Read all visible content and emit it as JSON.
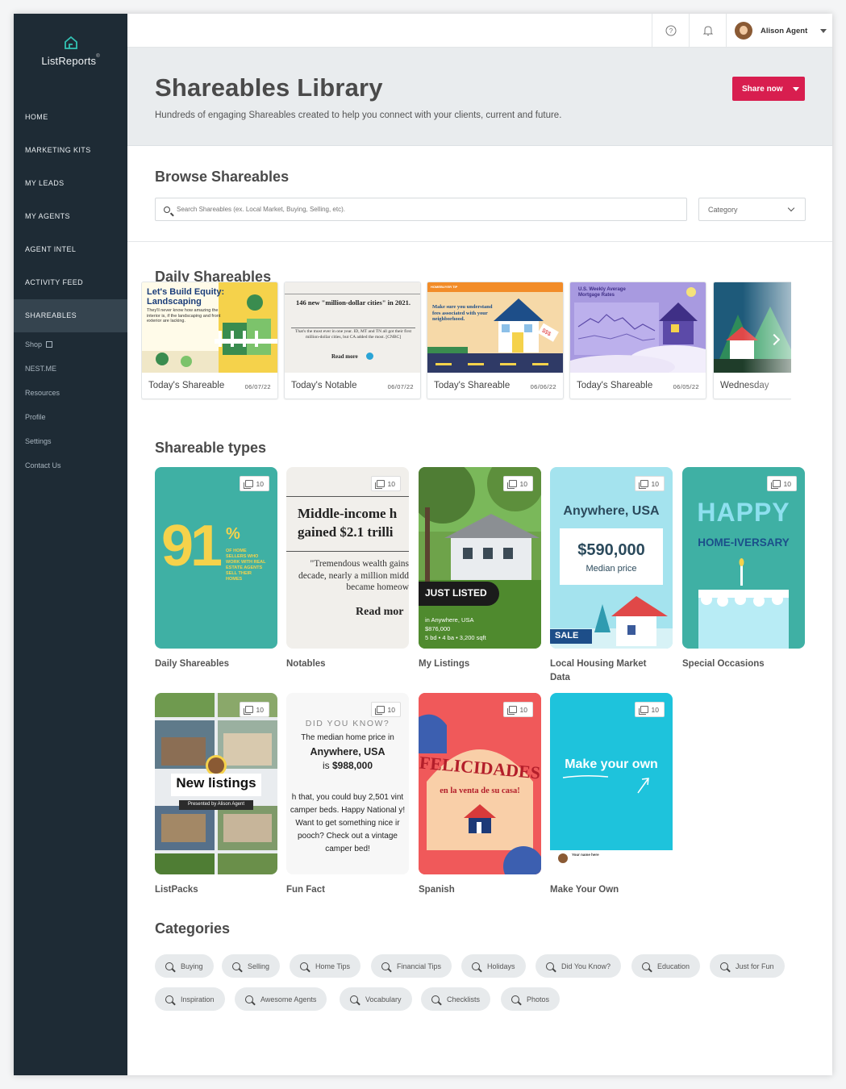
{
  "app": {
    "logo": "ListReports",
    "logo_mark": "®"
  },
  "sidebar": {
    "main": [
      "HOME",
      "MARKETING KITS",
      "MY LEADS",
      "MY AGENTS",
      "AGENT INTEL",
      "ACTIVITY FEED",
      "SHAREABLES"
    ],
    "active": "SHAREABLES",
    "sub": [
      "Shop",
      "NEST.ME",
      "Resources",
      "Profile",
      "Settings",
      "Contact Us"
    ]
  },
  "topbar": {
    "user_name": "Alison Agent"
  },
  "header": {
    "title": "Shareables Library",
    "subtitle": "Hundreds of engaging Shareables created to help you connect with your clients, current and future.",
    "share_button": "Share now"
  },
  "browse": {
    "title": "Browse Shareables",
    "search_placeholder": "Search Shareables (ex. Local Market, Buying, Selling, etc).",
    "category_label": "Category"
  },
  "daily": {
    "title": "Daily Shareables",
    "cards": [
      {
        "label": "Today's Shareable",
        "date": "06/07/22",
        "headline": "Let's Build Equity: Landscaping",
        "body": "They'll never know how amazing the interior is, if the landscaping and front exterior are lacking."
      },
      {
        "label": "Today's Notable",
        "date": "06/07/22",
        "headline": "146 new \"million-dollar cities\" in 2021.",
        "body": "That's the most ever in one year. ID, MT and TN all got their first million-dollar cities, but CA added the most. [CNBC]",
        "cta": "Read more"
      },
      {
        "label": "Today's Shareable",
        "date": "06/06/22",
        "tag": "HOMEBUYER TIP",
        "headline": "Make sure you understand fees associated with your neighborhood."
      },
      {
        "label": "Today's Shareable",
        "date": "06/05/22",
        "headline": "U.S. Weekly Average Mortgage Rates"
      },
      {
        "label": "Wednesday",
        "date": ""
      }
    ]
  },
  "types": {
    "title": "Shareable types",
    "items": [
      {
        "label": "Daily Shareables",
        "count": "10",
        "big": "91",
        "small": "%",
        "caption": "OF HOME SELLERS WHO WORK WITH REAL ESTATE AGENTS SELL THEIR HOMES"
      },
      {
        "label": "Notables",
        "count": "10",
        "headline": "Middle-income h gained $2.1 trilli",
        "body": "\"Tremendous wealth gains decade, nearly a million midd became homeow",
        "cta": "Read mor"
      },
      {
        "label": "My Listings",
        "count": "10",
        "badge": "JUST LISTED",
        "location": "in Anywhere, USA",
        "price": "$876,000",
        "specs": "5 bd • 4 ba • 3,200 sqft"
      },
      {
        "label": "Local Housing Market Data",
        "count": "10",
        "place": "Anywhere, USA",
        "price": "$590,000",
        "price_label": "Median price",
        "tag": "SALE"
      },
      {
        "label": "Special Occasions",
        "count": "10",
        "big": "HAPPY",
        "sub": "HOME-IVERSARY"
      },
      {
        "label": "ListPacks",
        "count": "10",
        "title": "New listings",
        "presenter": "Presented by Alison Agent"
      },
      {
        "label": "Fun Fact",
        "count": "10",
        "kicker": "DID YOU KNOW?",
        "line1": "The median home price in",
        "place": "Anywhere, USA",
        "line2": "is",
        "price": "$988,000",
        "body": "h that, you could buy 2,501 vint camper beds. Happy National y! Want to get something nice ir pooch? Check out a vintage camper bed!"
      },
      {
        "label": "Spanish",
        "count": "10",
        "title": "FELICIDADES",
        "subtitle": "en la venta de su casa!"
      },
      {
        "label": "Make Your Own",
        "count": "10",
        "title": "Make your own",
        "footer_name": "Your name here"
      }
    ]
  },
  "categories": {
    "title": "Categories",
    "row1": [
      "Buying",
      "Selling",
      "Home Tips",
      "Financial Tips",
      "Holidays",
      "Did You Know?",
      "Education",
      "Just for Fun"
    ],
    "row2": [
      "Inspiration",
      "Awesome Agents",
      "Vocabulary",
      "Checklists",
      "Photos"
    ]
  },
  "colors": {
    "sidebar": "#1e2b35",
    "accent": "#d81e4f",
    "teal": "#3fb0a4",
    "cyan": "#1ec3dc"
  }
}
